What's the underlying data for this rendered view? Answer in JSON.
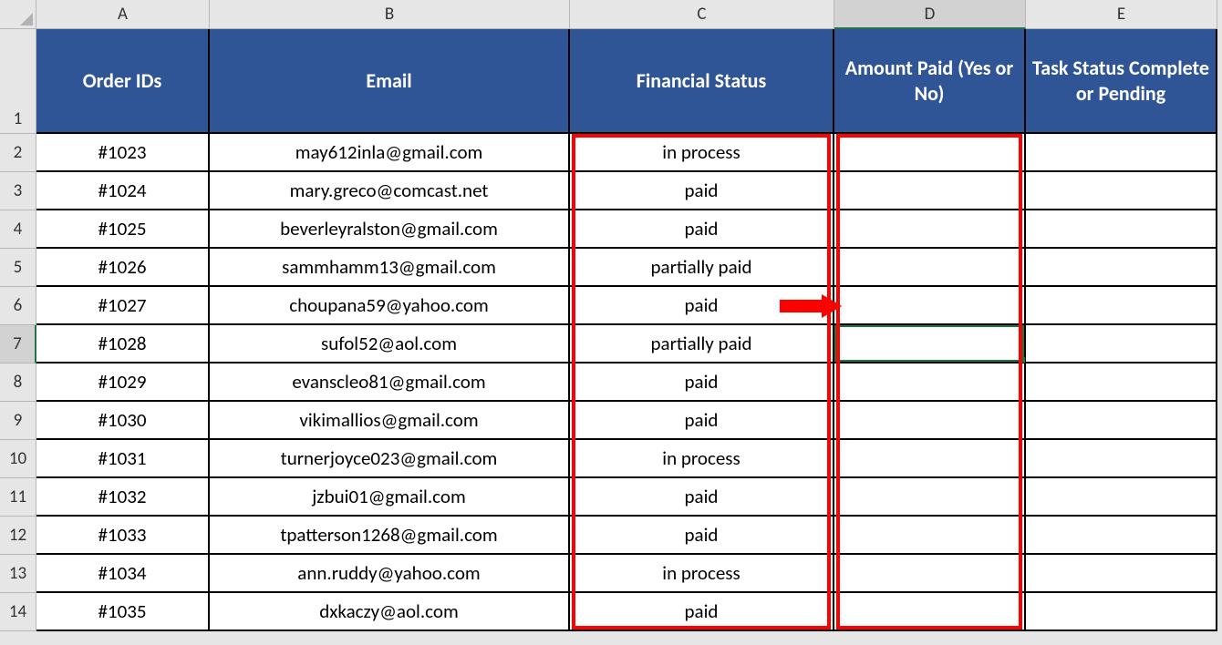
{
  "columns": [
    "A",
    "B",
    "C",
    "D",
    "E"
  ],
  "selectedColumn": "D",
  "selectedRow": 7,
  "headers": {
    "A": "Order IDs",
    "B": "Email",
    "C": "Financial Status",
    "D": "Amount Paid (Yes or No)",
    "E": "Task Status Complete or Pending"
  },
  "rows": [
    {
      "n": 2,
      "A": "#1023",
      "B": "may612inla@gmail.com",
      "C": "in process",
      "D": "",
      "E": ""
    },
    {
      "n": 3,
      "A": "#1024",
      "B": "mary.greco@comcast.net",
      "C": "paid",
      "D": "",
      "E": ""
    },
    {
      "n": 4,
      "A": "#1025",
      "B": "beverleyralston@gmail.com",
      "C": "paid",
      "D": "",
      "E": ""
    },
    {
      "n": 5,
      "A": "#1026",
      "B": "sammhamm13@gmail.com",
      "C": "partially paid",
      "D": "",
      "E": ""
    },
    {
      "n": 6,
      "A": "#1027",
      "B": "choupana59@yahoo.com",
      "C": "paid",
      "D": "",
      "E": ""
    },
    {
      "n": 7,
      "A": "#1028",
      "B": "sufol52@aol.com",
      "C": "partially paid",
      "D": "",
      "E": ""
    },
    {
      "n": 8,
      "A": "#1029",
      "B": "evanscleo81@gmail.com",
      "C": "paid",
      "D": "",
      "E": ""
    },
    {
      "n": 9,
      "A": "#1030",
      "B": "vikimallios@gmail.com",
      "C": "paid",
      "D": "",
      "E": ""
    },
    {
      "n": 10,
      "A": "#1031",
      "B": "turnerjoyce023@gmail.com",
      "C": "in process",
      "D": "",
      "E": ""
    },
    {
      "n": 11,
      "A": "#1032",
      "B": "jzbui01@gmail.com",
      "C": "paid",
      "D": "",
      "E": ""
    },
    {
      "n": 12,
      "A": "#1033",
      "B": "tpatterson1268@gmail.com",
      "C": "paid",
      "D": "",
      "E": ""
    },
    {
      "n": 13,
      "A": "#1034",
      "B": "ann.ruddy@yahoo.com",
      "C": "in process",
      "D": "",
      "E": ""
    },
    {
      "n": 14,
      "A": "#1035",
      "B": "dxkaczy@aol.com",
      "C": "paid",
      "D": "",
      "E": ""
    }
  ],
  "annotations": {
    "highlightColumns": [
      "C",
      "D"
    ],
    "arrowFrom": "C6",
    "arrowTo": "D6"
  },
  "colors": {
    "headerFill": "#2F5597",
    "highlight": "#ff0000",
    "selection": "#107c41"
  }
}
